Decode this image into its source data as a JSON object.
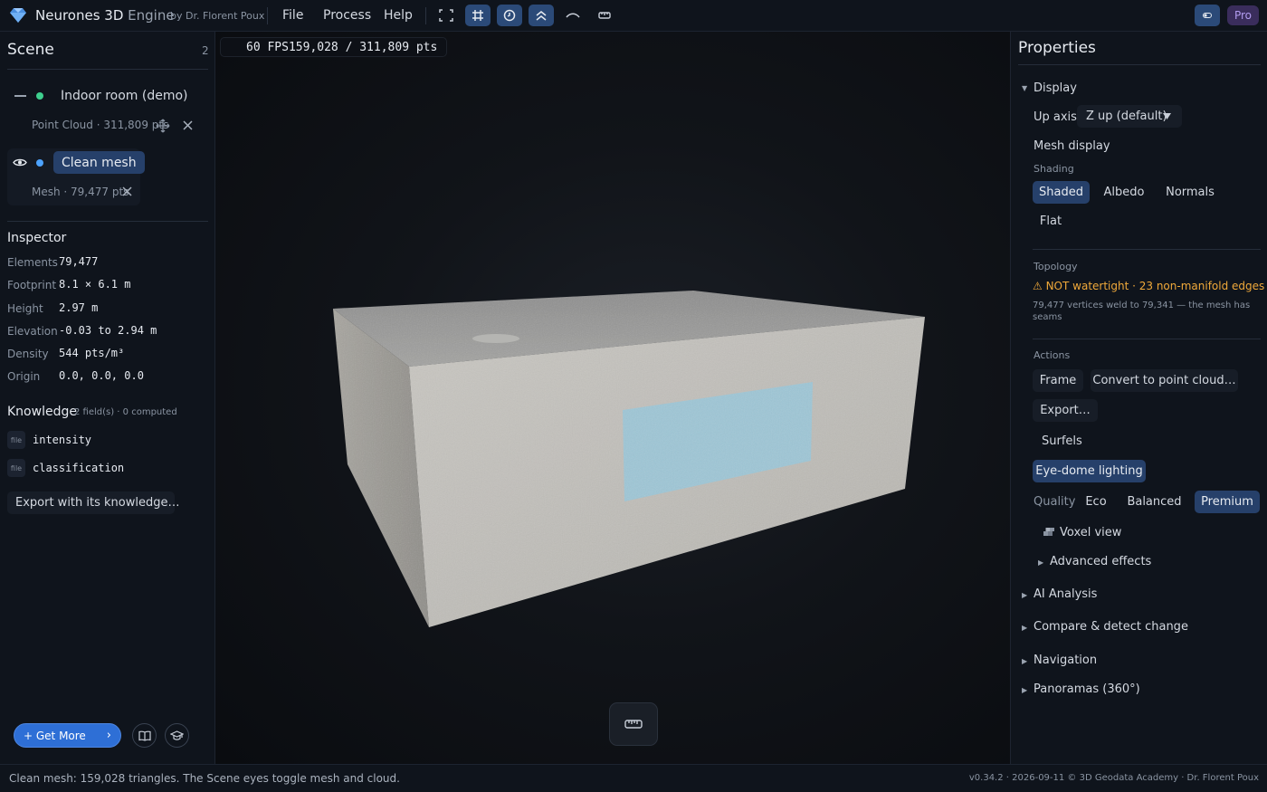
{
  "app": {
    "brand": "Neurones 3D",
    "brand_suffix": "Engine",
    "author": "by Dr. Florent Poux",
    "menu": [
      "File",
      "Process",
      "Help"
    ],
    "plan_badge": "Pro",
    "accent_color": "#2b4a78"
  },
  "scene": {
    "title": "Scene",
    "count": "2",
    "layers": [
      {
        "name": "Indoor room (demo)",
        "sub": "Point Cloud · 311,809 pts",
        "dot_color": "#3ecf8e",
        "visible": false
      },
      {
        "name": "Clean mesh",
        "sub": "Mesh · 79,477 pts",
        "dot_color": "#4da3ff",
        "visible": true
      }
    ]
  },
  "inspector": {
    "title": "Inspector",
    "rows": [
      {
        "label": "Elements",
        "value": "79,477"
      },
      {
        "label": "Footprint",
        "value": "8.1 × 6.1 m"
      },
      {
        "label": "Height",
        "value": "2.97 m"
      },
      {
        "label": "Elevation",
        "value": "-0.03 to 2.94 m"
      },
      {
        "label": "Density",
        "value": "544 pts/m³"
      },
      {
        "label": "Origin",
        "value": "0.0, 0.0, 0.0"
      }
    ]
  },
  "knowledge": {
    "title": "Knowledge",
    "subtitle": "2 field(s) · 0 computed",
    "badge": "file",
    "fields": [
      "intensity",
      "classification"
    ],
    "export_label": "Export with its knowledge…"
  },
  "left_footer": {
    "get_more": "+ Get More",
    "chevron": "›"
  },
  "viewport": {
    "fps": "60 FPS",
    "points": "159,028 / 311,809 pts"
  },
  "properties": {
    "title": "Properties",
    "display": {
      "title": "Display",
      "up_axis_label": "Up axis",
      "up_axis_value": "Z up (default)",
      "mesh_display": "Mesh display",
      "shading_label": "Shading",
      "shading_options": [
        "Shaded",
        "Albedo",
        "Normals",
        "Flat"
      ],
      "shading_selected": "Shaded",
      "topology_label": "Topology",
      "topology_warning": "NOT watertight · 23 non-manifold edges",
      "topology_detail": "79,477 vertices weld to 79,341 — the mesh has seams",
      "actions_label": "Actions",
      "actions": [
        "Frame",
        "Convert to point cloud…",
        "Export…"
      ],
      "surfels": "Surfels",
      "edl": "Eye-dome lighting",
      "quality_label": "Quality",
      "quality_options": [
        "Eco",
        "Balanced",
        "Premium"
      ],
      "quality_selected": "Premium",
      "voxel_view": "Voxel view",
      "advanced": "Advanced effects"
    },
    "sections": [
      "AI Analysis",
      "Compare & detect change",
      "Navigation",
      "Panoramas (360°)"
    ]
  },
  "status": {
    "message": "Clean mesh: 159,028 triangles. The Scene eyes toggle mesh and cloud.",
    "version": "v0.34.2 · 2026-09-11  © 3D Geodata Academy · Dr. Florent Poux"
  }
}
